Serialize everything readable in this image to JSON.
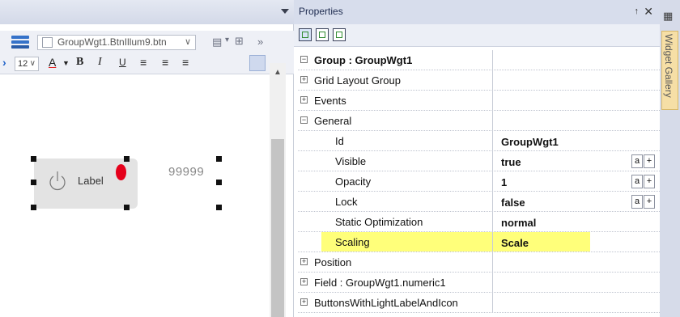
{
  "editor": {
    "object_selector": "GroupWgt1.BtnIllum9.btn",
    "font_size": "12",
    "toolbar_glyphs": {
      "more": "»",
      "font_color": "A",
      "bold": "B",
      "italic": "I",
      "underline": "U"
    },
    "widget": {
      "label": "Label",
      "numeric_text": "99999",
      "led_color": "#e5001b"
    }
  },
  "properties": {
    "title": "Properties",
    "pin_glyph": "↑",
    "close_glyph": "✕",
    "rows": [
      {
        "kind": "category",
        "expander": "−",
        "label": "Group : GroupWgt1",
        "bold": true
      },
      {
        "kind": "category",
        "expander": "+",
        "label": "Grid Layout Group"
      },
      {
        "kind": "category",
        "expander": "+",
        "label": "Events"
      },
      {
        "kind": "category",
        "expander": "−",
        "label": "General"
      },
      {
        "kind": "property",
        "name": "Id",
        "value": "GroupWgt1"
      },
      {
        "kind": "property",
        "name": "Visible",
        "value": "true",
        "buttons": true
      },
      {
        "kind": "property",
        "name": "Opacity",
        "value": "1",
        "buttons": true
      },
      {
        "kind": "property",
        "name": "Lock",
        "value": "false",
        "buttons": true
      },
      {
        "kind": "property",
        "name": "Static Optimization",
        "value": "normal"
      },
      {
        "kind": "property",
        "name": "Scaling",
        "value": "Scale",
        "highlight": true
      },
      {
        "kind": "category",
        "expander": "+",
        "label": "Position"
      },
      {
        "kind": "category",
        "expander": "+",
        "label": "Field : GroupWgt1.numeric1"
      },
      {
        "kind": "category",
        "expander": "+",
        "label": "ButtonsWithLightLabelAndIcon"
      }
    ],
    "button_a": "a",
    "button_plus": "+",
    "highlight_color": "#ffff7a"
  },
  "gallery": {
    "label": "Widget Gallery"
  }
}
